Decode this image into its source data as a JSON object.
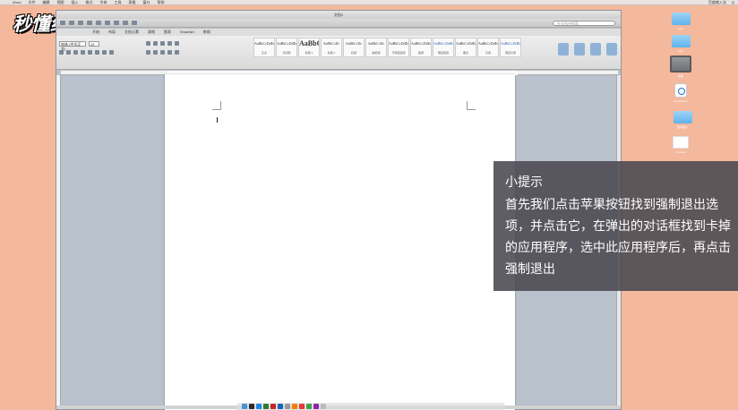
{
  "menubar": {
    "items": [
      "Word",
      "文件",
      "编辑",
      "视图",
      "插入",
      "格式",
      "字体",
      "工具",
      "表格",
      "窗口",
      "帮助"
    ],
    "right_items": [
      "百度输入法",
      "Q"
    ]
  },
  "watermark": {
    "text": "秒懂经验"
  },
  "window": {
    "title": "文档1",
    "search_placeholder": "在文档中搜索",
    "tabs": [
      "开始",
      "布局",
      "文档元素",
      "表格",
      "图表",
      "SmartArt",
      "审阅"
    ],
    "font_name": "宋体 (中文正文)",
    "font_size": "12",
    "styles": [
      {
        "preview": "AaBbCcDdEe",
        "name": "正文",
        "big": false,
        "blue": false
      },
      {
        "preview": "AaBbCcDdEe",
        "name": "无间隔",
        "big": false,
        "blue": false
      },
      {
        "preview": "AaBbC",
        "name": "标题 1",
        "big": true,
        "blue": false
      },
      {
        "preview": "AaBbCcDc",
        "name": "标题 2",
        "big": false,
        "blue": false
      },
      {
        "preview": "AaBbCcDc",
        "name": "标题",
        "big": false,
        "blue": false
      },
      {
        "preview": "AaBbCcDc",
        "name": "副标题",
        "big": false,
        "blue": false
      },
      {
        "preview": "AaBbCcDdEe",
        "name": "不明显强调",
        "big": false,
        "blue": false
      },
      {
        "preview": "AaBbCcDdEe",
        "name": "强调",
        "big": false,
        "blue": false
      },
      {
        "preview": "AaBbCcDdEe",
        "name": "明显强调",
        "big": false,
        "blue": true
      },
      {
        "preview": "AaBbCcDdEe",
        "name": "要点",
        "big": false,
        "blue": false
      },
      {
        "preview": "AaBbCcDdEe",
        "name": "引用",
        "big": false,
        "blue": false
      },
      {
        "preview": "AaBbCcDdEe",
        "name": "明显引用",
        "big": false,
        "blue": true
      }
    ]
  },
  "desktop": {
    "icons": [
      {
        "label": "1111"
      },
      {
        "label": "1111"
      },
      {
        "label": "截图"
      },
      {
        "label": "AA Security"
      },
      {
        "label": "相关图片"
      },
      {
        "label": "111.docx"
      }
    ]
  },
  "tip": {
    "title": "小提示",
    "body": "首先我们点击苹果按钮找到强制退出选项，并点击它，在弹出的对话框找到卡掉的应用程序，选中此应用程序后，再点击强制退出"
  }
}
